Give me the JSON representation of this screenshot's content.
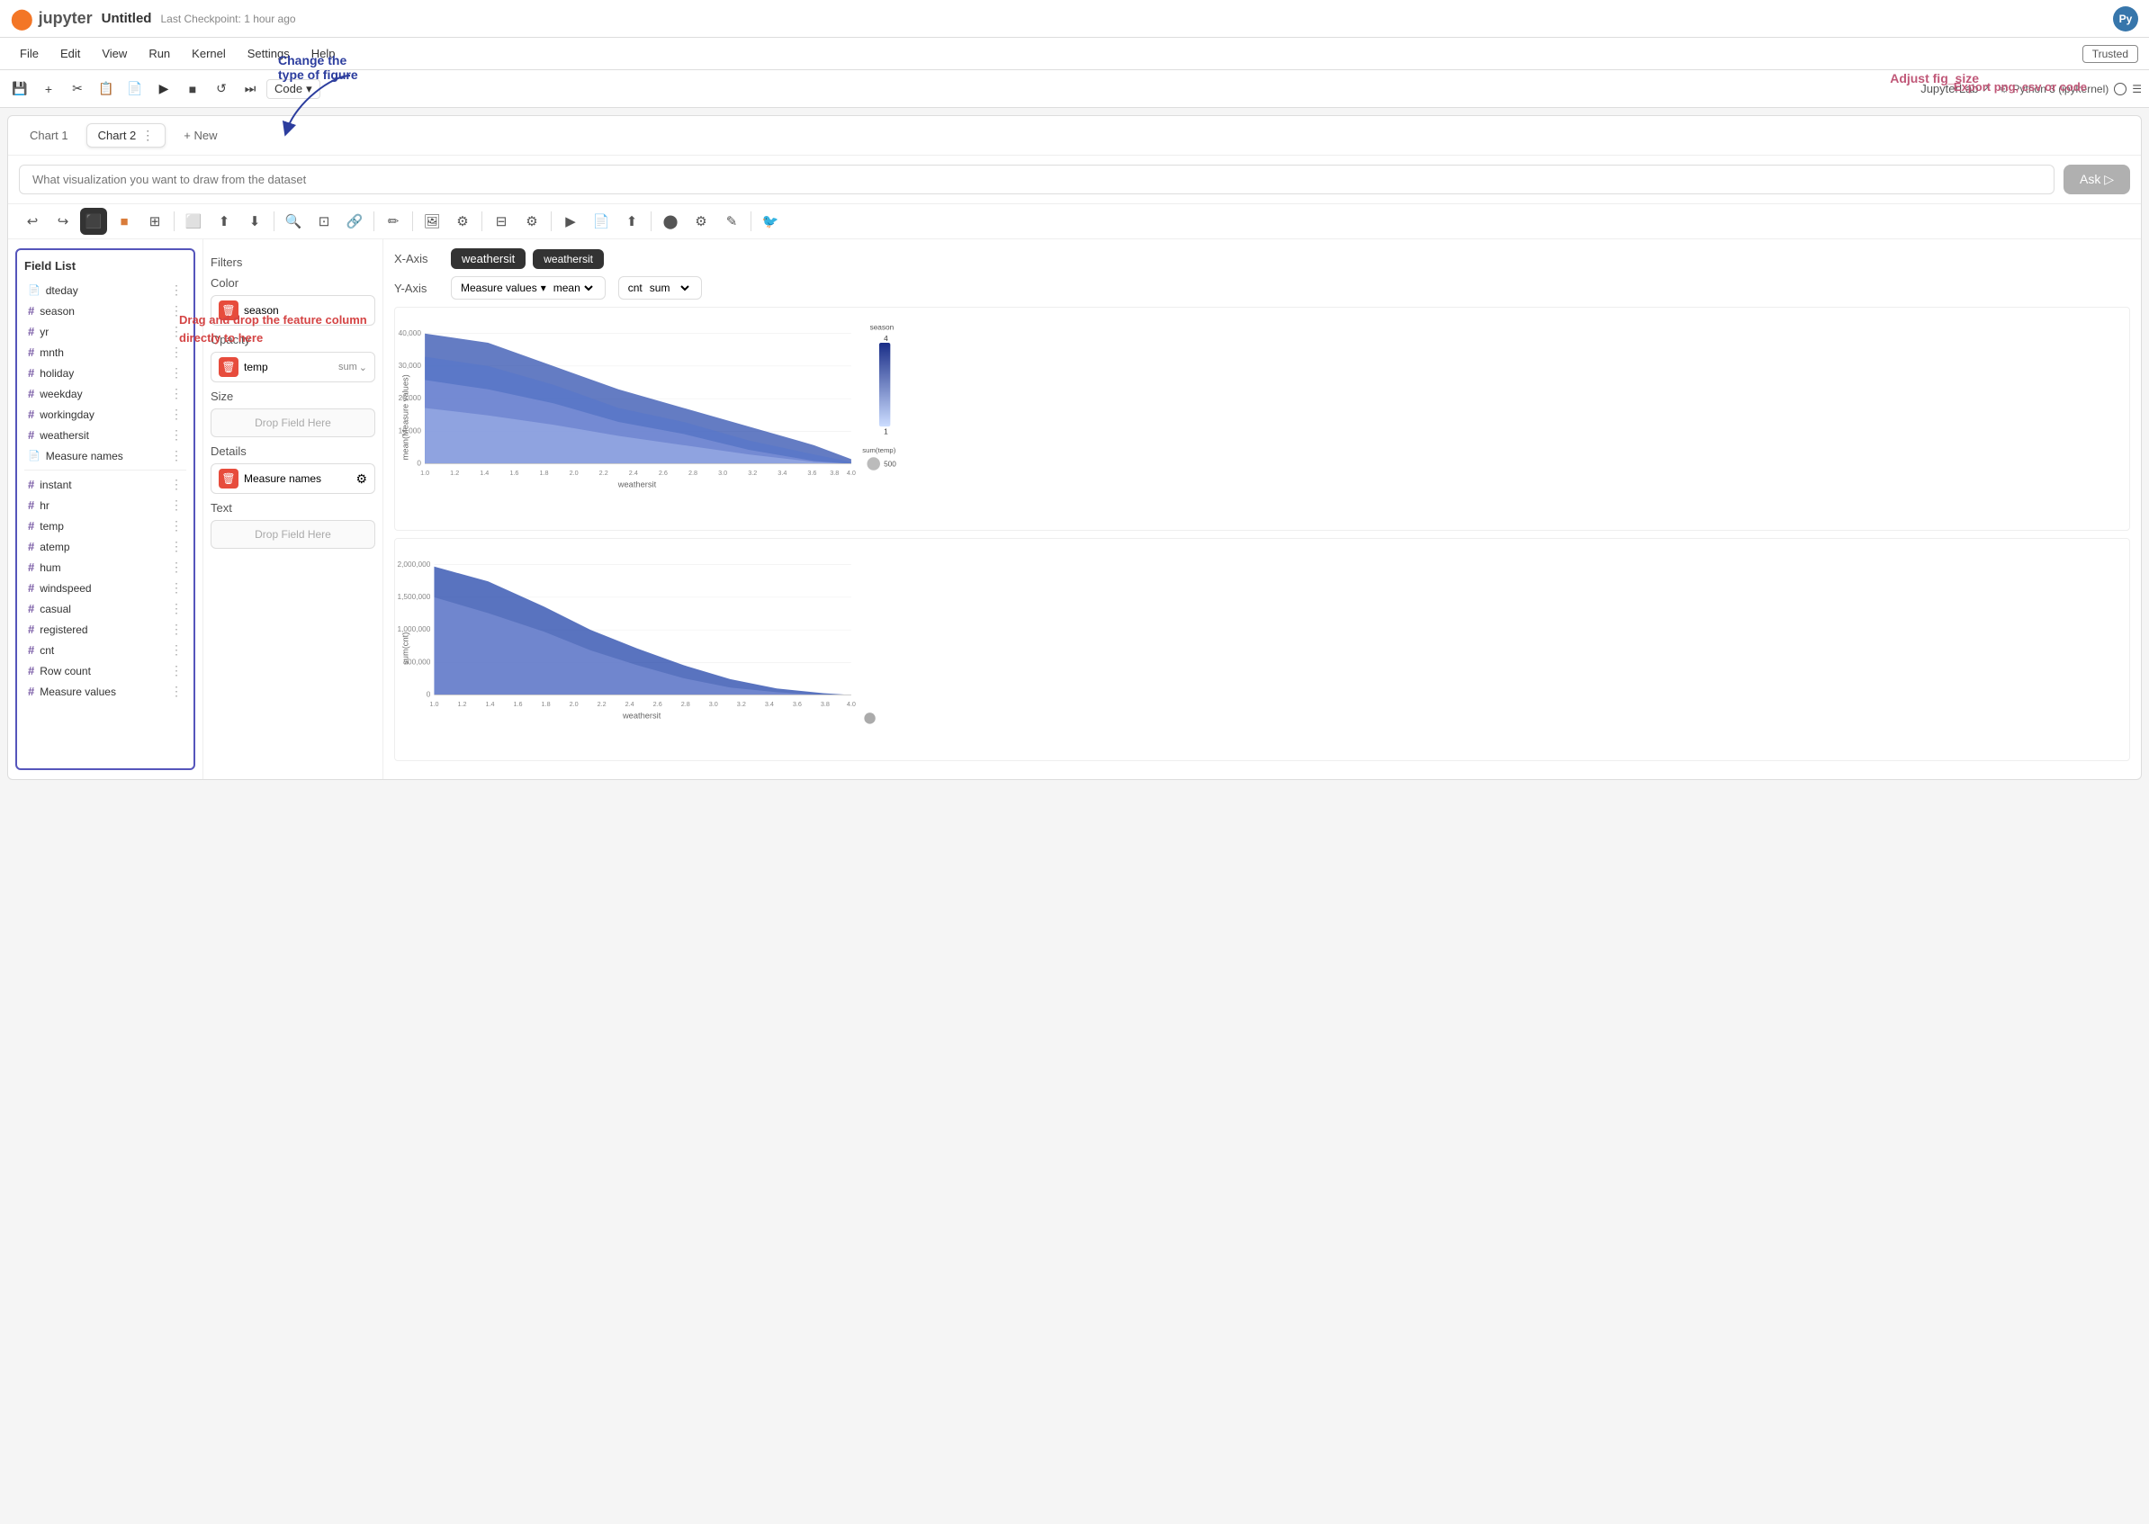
{
  "topbar": {
    "logo": "🔶",
    "app_name": "jupyter",
    "notebook_title": "Untitled",
    "checkpoint": "Last Checkpoint: 1 hour ago",
    "python_label": "Py"
  },
  "menubar": {
    "items": [
      "File",
      "Edit",
      "View",
      "Run",
      "Kernel",
      "Settings",
      "Help"
    ],
    "trusted": "Trusted"
  },
  "toolbar": {
    "code_label": "Code",
    "jupyterlab": "JupyterLab",
    "kernel": "Python 3 (ipykernel)"
  },
  "tabs": {
    "tab1_label": "Chart 1",
    "tab2_label": "Chart 2",
    "tab2_kebab": "⋮",
    "new_tab": "+ New"
  },
  "annotations": {
    "change_type": "Change the\ntype of figure",
    "fig_size": "Adjust fig_size",
    "drag_drop": "Drag and drop the feature\ncolumn directly to here",
    "export": "Export png, csv or code"
  },
  "search": {
    "placeholder": "What visualization you want to draw from the dataset",
    "ask_btn": "Ask ▷"
  },
  "field_list": {
    "title": "Field List",
    "fields": [
      {
        "type": "doc",
        "name": "dteday"
      },
      {
        "type": "hash",
        "name": "season"
      },
      {
        "type": "hash",
        "name": "yr"
      },
      {
        "type": "hash",
        "name": "mnth"
      },
      {
        "type": "hash",
        "name": "holiday"
      },
      {
        "type": "hash",
        "name": "weekday"
      },
      {
        "type": "hash",
        "name": "workingday"
      },
      {
        "type": "hash",
        "name": "weathersit"
      },
      {
        "type": "doc",
        "name": "Measure names"
      },
      {
        "type": "hash",
        "name": "instant"
      },
      {
        "type": "hash",
        "name": "hr"
      },
      {
        "type": "hash",
        "name": "temp"
      },
      {
        "type": "hash",
        "name": "atemp"
      },
      {
        "type": "hash",
        "name": "hum"
      },
      {
        "type": "hash",
        "name": "windspeed"
      },
      {
        "type": "hash",
        "name": "casual"
      },
      {
        "type": "hash",
        "name": "registered"
      },
      {
        "type": "hash",
        "name": "cnt"
      },
      {
        "type": "hash",
        "name": "Row count"
      },
      {
        "type": "hash",
        "name": "Measure values"
      }
    ]
  },
  "filters": {
    "title": "Filters",
    "color_title": "Color",
    "color_chip": {
      "name": "season",
      "agg": ""
    },
    "opacity_title": "Opacity",
    "opacity_chip": {
      "name": "temp",
      "agg": "sum"
    },
    "size_title": "Size",
    "size_drop": "Drop Field Here",
    "details_title": "Details",
    "details_chip": {
      "name": "Measure names",
      "has_settings": true
    },
    "text_title": "Text",
    "text_drop": "Drop Field Here"
  },
  "axes": {
    "x_label": "X-Axis",
    "x_value": "weathersit",
    "y_label": "Y-Axis",
    "y_chips": [
      {
        "name": "Measure values",
        "agg": "mean"
      },
      {
        "name": "cnt",
        "agg": "sum"
      }
    ]
  },
  "chart": {
    "top": {
      "y_label": "mean(Measure values)",
      "x_label": "weathersit",
      "y_ticks": [
        "40,000",
        "30,000",
        "20,000",
        "10,000",
        "0"
      ],
      "x_ticks": [
        "1.0",
        "1.2",
        "1.4",
        "1.6",
        "1.8",
        "2.0",
        "2.2",
        "2.4",
        "2.6",
        "2.8",
        "3.0",
        "3.2",
        "3.4",
        "3.6",
        "3.8",
        "4.0"
      ],
      "legend_title": "season",
      "legend_max": "4",
      "legend_min": "1",
      "size_legend": "sum(temp)",
      "size_val": "500"
    },
    "bottom": {
      "y_label": "sum(cnt)",
      "x_label": "weathersit",
      "y_ticks": [
        "2,000,000",
        "1,500,000",
        "1,000,000",
        "500,000",
        "0"
      ],
      "x_ticks": [
        "1.0",
        "1.2",
        "1.4",
        "1.6",
        "1.8",
        "2.0",
        "2.2",
        "2.4",
        "2.6",
        "2.8",
        "3.0",
        "3.2",
        "3.4",
        "3.6",
        "3.8",
        "4.0"
      ]
    }
  },
  "tooltip": "weathersit",
  "icons": {
    "undo": "↩",
    "redo": "↪",
    "cube": "⬛",
    "color_picker": "🎨",
    "layers": "⊞",
    "transform": "⬜",
    "arrows_up": "⬆",
    "arrows_down": "⬇",
    "zoom_out": "🔍",
    "fit": "⊡",
    "link": "🔗",
    "pen": "✏",
    "image": "🖼",
    "gear": "⚙",
    "table": "⊟",
    "settings2": "⚙",
    "play": "▶",
    "doc_gear": "📄",
    "export": "⬆",
    "connect": "⬤",
    "eraser": "✎",
    "bird": "🐦"
  }
}
